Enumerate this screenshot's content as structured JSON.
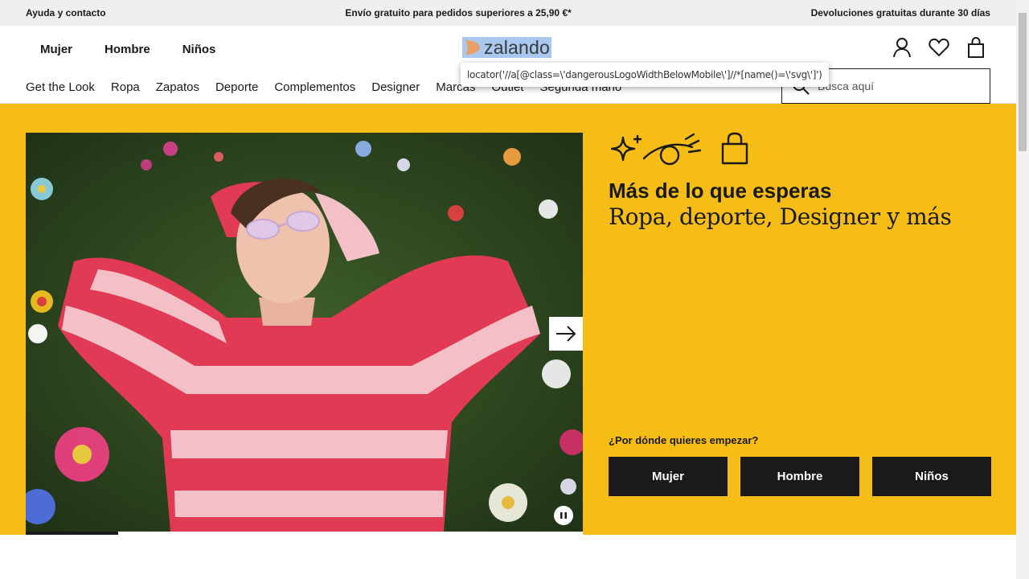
{
  "topbar": {
    "help": "Ayuda y contacto",
    "shipping": "Envío gratuito para pedidos superiores a 25,90 €*",
    "returns": "Devoluciones gratuitas durante 30 días"
  },
  "header": {
    "gender_nav": [
      "Mujer",
      "Hombre",
      "Niños"
    ],
    "logo_text": "zalando",
    "logo_color": "#e8a06a",
    "icons": [
      "user-icon",
      "heart-icon",
      "bag-icon"
    ]
  },
  "category_nav": [
    "Get the Look",
    "Ropa",
    "Zapatos",
    "Deporte",
    "Complementos",
    "Designer",
    "Marcas",
    "Outlet",
    "Segunda mano"
  ],
  "search": {
    "placeholder": "Busca aquí"
  },
  "tooltip": {
    "text": "locator('//a[@class=\\'dangerousLogoWidthBelowMobile\\']//*[name()=\\'svg\\']')"
  },
  "hero": {
    "background": "#f6bd16",
    "headline": "Más de lo que esperas",
    "subline": "Ropa, deporte, Designer y más",
    "question": "¿Por dónde quieres empezar?",
    "ctas": [
      "Mujer",
      "Hombre",
      "Niños"
    ],
    "carousel_progress": 0.166
  }
}
